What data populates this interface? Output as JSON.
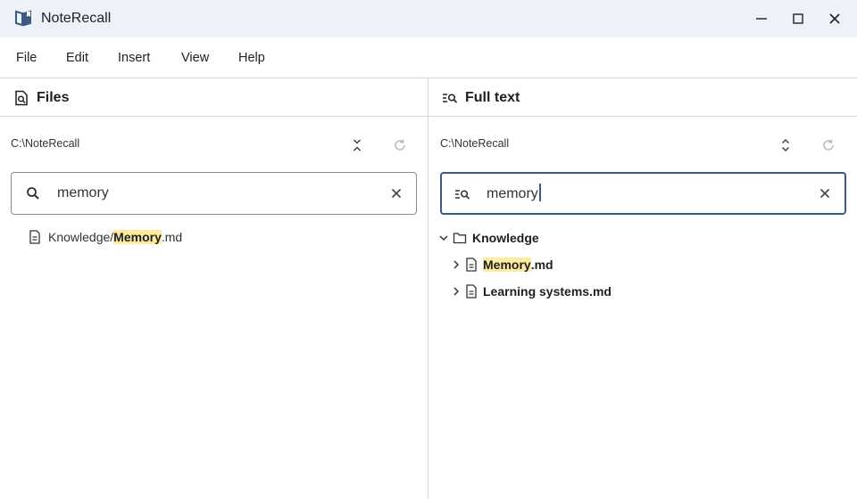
{
  "window": {
    "title": "NoteRecall",
    "controls": [
      "minimize",
      "maximize",
      "close"
    ]
  },
  "menu": [
    "File",
    "Edit",
    "Insert",
    "View",
    "Help"
  ],
  "files_pane": {
    "title": "Files",
    "path": "C:\\NoteRecall",
    "search_value": "memory",
    "results": [
      {
        "prefix": "Knowledge/",
        "highlight": "Memory",
        "suffix": ".md"
      }
    ]
  },
  "fulltext_pane": {
    "title": "Full text",
    "path": "C:\\NoteRecall",
    "search_value": "memory",
    "tree": {
      "folder": "Knowledge",
      "files": [
        {
          "highlight": "Memory",
          "suffix": ".md"
        },
        {
          "label": "Learning systems.md"
        }
      ]
    }
  },
  "colors": {
    "titlebar_bg": "#eef1f8",
    "highlight": "#fdeba0",
    "focus_border": "#3b5b85"
  }
}
